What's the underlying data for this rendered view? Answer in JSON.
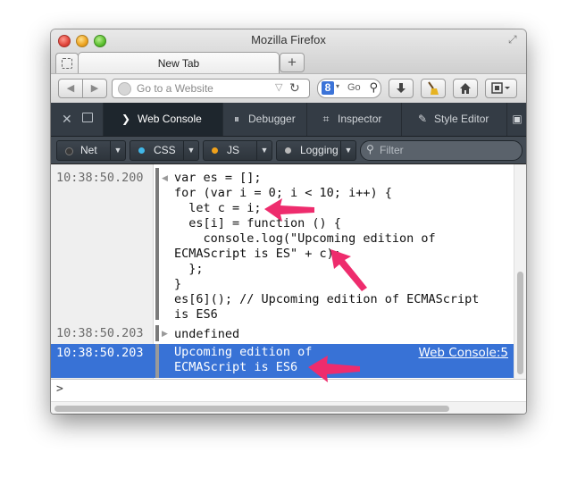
{
  "window": {
    "title": "Mozilla Firefox"
  },
  "tabs": [
    {
      "label": "New Tab"
    }
  ],
  "navbar": {
    "url_placeholder": "Go to a Website",
    "search_text": "Go",
    "search_engine_letter": "8"
  },
  "devtools": {
    "tabs": [
      {
        "label": "Web Console",
        "icon": "console-icon"
      },
      {
        "label": "Debugger",
        "icon": "debugger-icon"
      },
      {
        "label": "Inspector",
        "icon": "inspector-icon"
      },
      {
        "label": "Style Editor",
        "icon": "style-editor-icon"
      }
    ],
    "filters": [
      {
        "label": "Net",
        "color": "#3a3a3a"
      },
      {
        "label": "CSS",
        "color": "#41b7e8"
      },
      {
        "label": "JS",
        "color": "#f0a11b"
      },
      {
        "label": "Logging",
        "color": "#b9b9b9"
      }
    ],
    "filter_placeholder": "Filter"
  },
  "console": {
    "entries": [
      {
        "timestamp": "10:38:50.200",
        "lines": [
          "var es = [];",
          "for (var i = 0; i < 10; i++) {",
          "  let c = i;",
          "  es[i] = function () {",
          "    console.log(\"Upcoming edition of",
          "ECMAScript is ES\" + c);",
          "  };",
          "}",
          "es[6](); // Upcoming edition of ECMAScript",
          "is ES6"
        ]
      },
      {
        "timestamp": "10:38:50.203",
        "lines": [
          "undefined"
        ]
      },
      {
        "timestamp": "10:38:50.203",
        "lines": [
          "Upcoming edition of",
          "ECMAScript is ES6"
        ],
        "source": "Web Console:5"
      }
    ],
    "prompt": ">"
  },
  "colors": {
    "selection": "#3872d6",
    "annotation_arrow": "#ee2c6d",
    "devtools_bg": "#343c45"
  }
}
